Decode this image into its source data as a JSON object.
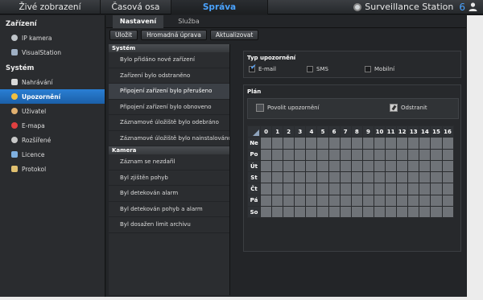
{
  "topnav": {
    "tabs": [
      "Živé zobrazení",
      "Časová osa",
      "Správa"
    ],
    "brand": "Surveillance Station",
    "version": "6"
  },
  "sidebar": {
    "section1": "Zařízení",
    "items1": [
      {
        "label": "IP kamera",
        "icon": "camera-icon"
      },
      {
        "label": "VisualStation",
        "icon": "visualstation-icon"
      }
    ],
    "section2": "Systém",
    "items2": [
      {
        "label": "Nahrávání",
        "icon": "recording-icon"
      },
      {
        "label": "Upozornění",
        "icon": "notification-icon"
      },
      {
        "label": "Uživatel",
        "icon": "user-icon"
      },
      {
        "label": "E-mapa",
        "icon": "emap-icon"
      },
      {
        "label": "Rozšířené",
        "icon": "advanced-icon"
      },
      {
        "label": "Licence",
        "icon": "license-icon"
      },
      {
        "label": "Protokol",
        "icon": "log-icon"
      }
    ]
  },
  "subtabs": [
    "Nastavení",
    "Služba"
  ],
  "toolbar": {
    "save": "Uložit",
    "bulk": "Hromadná úprava",
    "refresh": "Aktualizovat"
  },
  "events": {
    "system_header": "Systém",
    "system": [
      "Bylo přidáno nové zařízení",
      "Zařízení bylo odstraněno",
      "Připojení zařízení bylo přerušeno",
      "Připojení zařízení bylo obnoveno",
      "Záznamové úložiště bylo odebráno",
      "Záznamové úložiště bylo nainstalováno"
    ],
    "camera_header": "Kamera",
    "camera": [
      "Záznam se nezdařil",
      "Byl zjištěn pohyb",
      "Byl detekován alarm",
      "Byl detekován pohyb a alarm",
      "Byl dosažen limit archivu"
    ]
  },
  "notify_type": {
    "title": "Typ upozornění",
    "email": "E-mail",
    "sms": "SMS",
    "mobile": "Mobilní"
  },
  "plan": {
    "title": "Plán",
    "enable": "Povolit upozornění",
    "remove": "Odstranit",
    "hours": [
      "0",
      "1",
      "2",
      "3",
      "4",
      "5",
      "6",
      "7",
      "8",
      "9",
      "10",
      "11",
      "12",
      "13",
      "14",
      "15",
      "16"
    ],
    "days": [
      "Ne",
      "Po",
      "Út",
      "St",
      "Čt",
      "Pá",
      "So"
    ]
  },
  "colors": {
    "accent": "#4aa3ff",
    "active": "#2276c9",
    "cell": "#6f7378"
  }
}
